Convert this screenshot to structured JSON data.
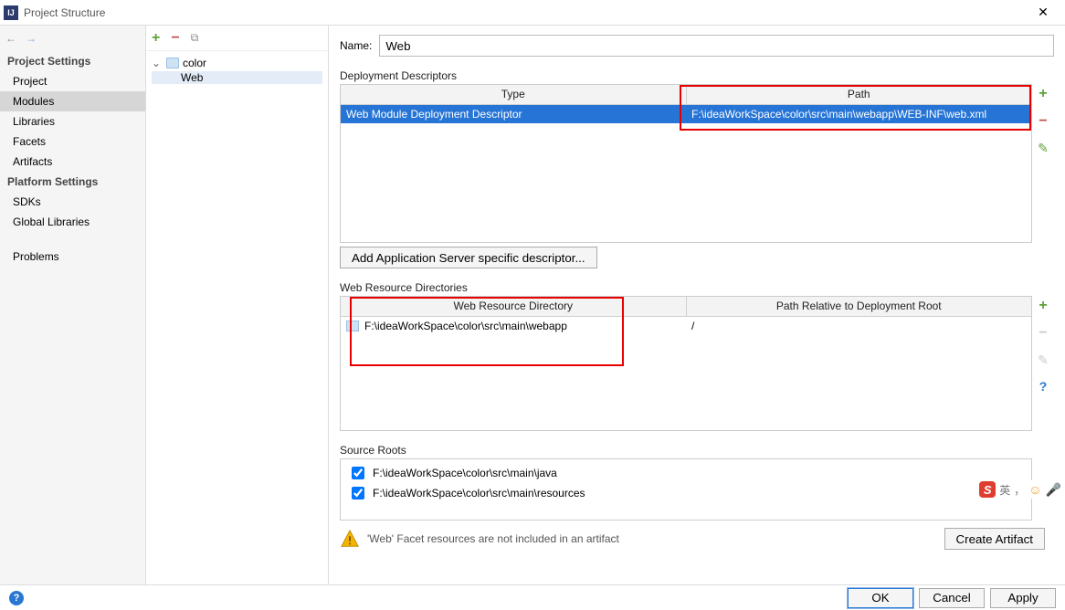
{
  "title": "Project Structure",
  "sidebar": {
    "projectHeading": "Project Settings",
    "items": [
      "Project",
      "Modules",
      "Libraries",
      "Facets",
      "Artifacts"
    ],
    "selectedIndex": 1,
    "platformHeading": "Platform Settings",
    "platformItems": [
      "SDKs",
      "Global Libraries"
    ],
    "problems": "Problems"
  },
  "tree": {
    "root": "color",
    "child": "Web"
  },
  "main": {
    "nameLabel": "Name:",
    "nameValue": "Web",
    "deploy": {
      "label": "Deployment Descriptors",
      "cols": [
        "Type",
        "Path"
      ],
      "row": {
        "type": "Web Module Deployment Descriptor",
        "path": "F:\\ideaWorkSpace\\color\\src\\main\\webapp\\WEB-INF\\web.xml"
      },
      "addBtn": "Add Application Server specific descriptor..."
    },
    "res": {
      "label": "Web Resource Directories",
      "cols": [
        "Web Resource Directory",
        "Path Relative to Deployment Root"
      ],
      "row": {
        "dir": "F:\\ideaWorkSpace\\color\\src\\main\\webapp",
        "rel": "/"
      }
    },
    "sources": {
      "label": "Source Roots",
      "rows": [
        "F:\\ideaWorkSpace\\color\\src\\main\\java",
        "F:\\ideaWorkSpace\\color\\src\\main\\resources"
      ]
    },
    "warn": {
      "text": "'Web' Facet resources are not included in an artifact",
      "btn": "Create Artifact"
    }
  },
  "footer": {
    "ok": "OK",
    "cancel": "Cancel",
    "apply": "Apply"
  },
  "ime": {
    "lang": "英",
    "sep": "，"
  }
}
